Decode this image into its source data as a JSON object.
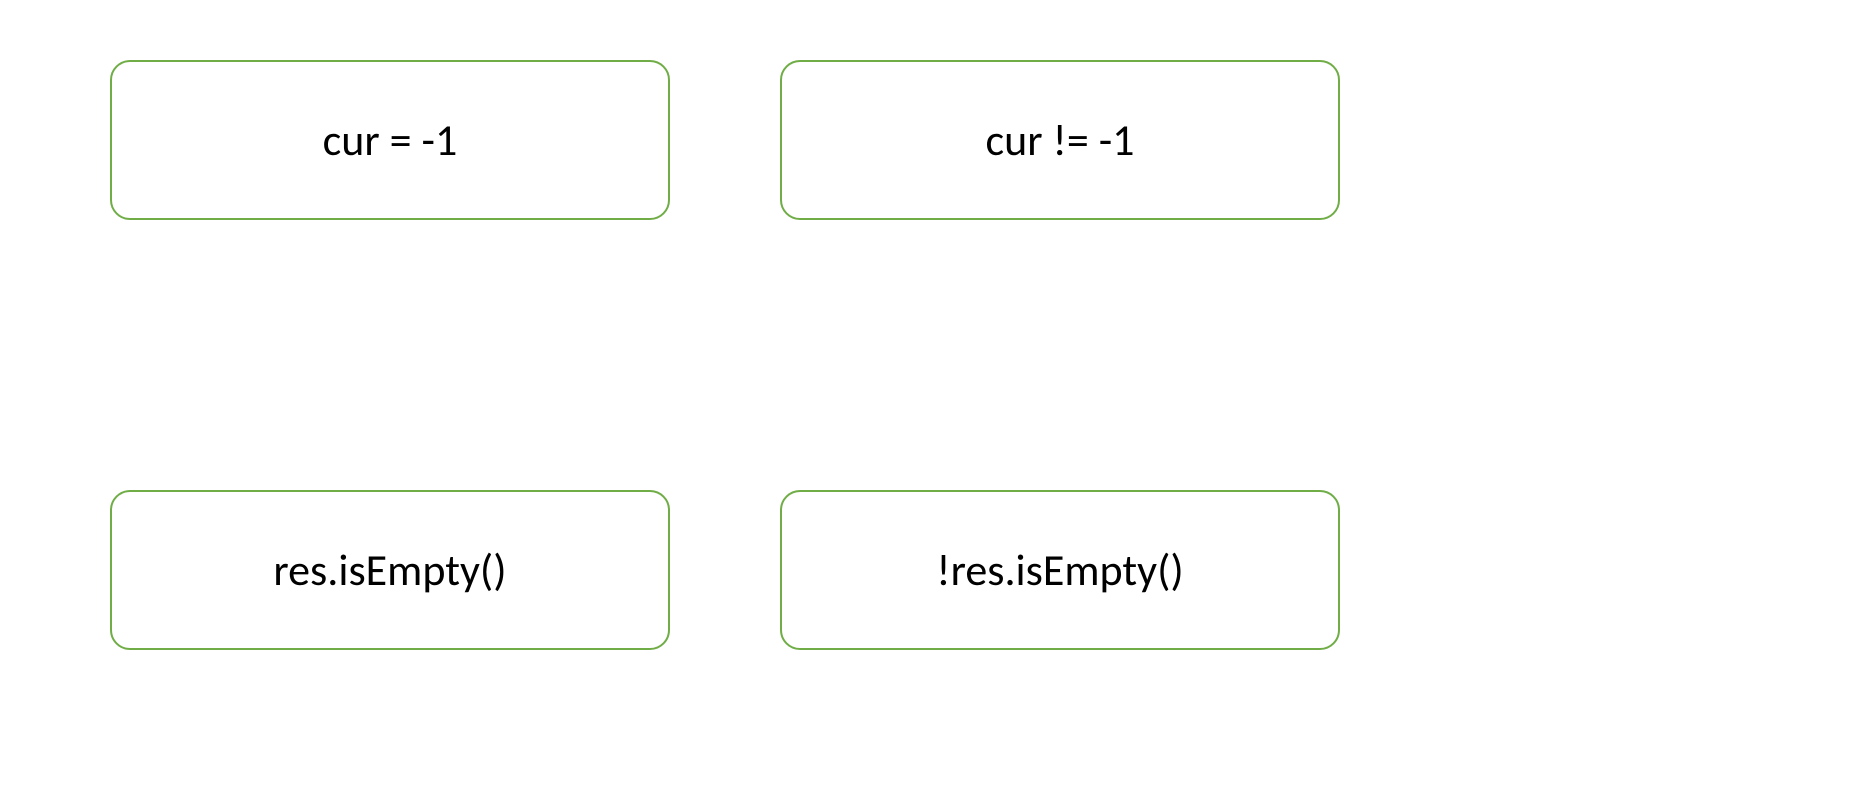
{
  "nodes": {
    "topLeft": "cur = -1",
    "topRight": "cur != -1",
    "bottomLeft": "res.isEmpty()",
    "bottomRight": "!res.isEmpty()"
  }
}
